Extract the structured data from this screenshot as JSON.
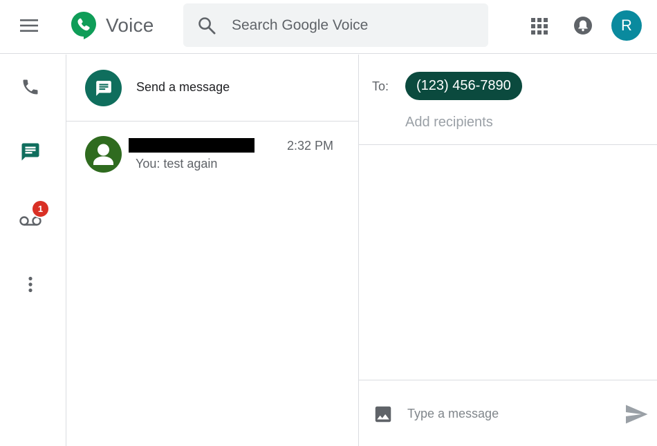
{
  "header": {
    "app_title": "Voice",
    "search_placeholder": "Search Google Voice",
    "avatar_initial": "R",
    "icons": [
      "menu-icon",
      "voice-logo-icon",
      "search-icon",
      "apps-grid-icon",
      "notifications-icon"
    ]
  },
  "rail": {
    "items": [
      {
        "name": "calls",
        "icon": "phone-icon"
      },
      {
        "name": "messages",
        "icon": "message-icon",
        "active": true
      },
      {
        "name": "voicemail",
        "icon": "voicemail-icon",
        "badge": "1"
      },
      {
        "name": "more",
        "icon": "more-vert-icon"
      }
    ]
  },
  "list": {
    "send_label": "Send a message",
    "conversations": [
      {
        "name_redacted": true,
        "time": "2:32 PM",
        "preview": "You: test again"
      }
    ]
  },
  "compose": {
    "to_label": "To:",
    "recipient_chip": "(123) 456-7890",
    "add_recipients_placeholder": "Add recipients",
    "message_placeholder": "Type a message"
  },
  "colors": {
    "accent_green": "#0f6e5d",
    "chip_bg": "#0b4a3e",
    "avatar_teal": "#0a8a9e",
    "badge_red": "#d93025",
    "contact_avatar": "#2f6b1f"
  }
}
